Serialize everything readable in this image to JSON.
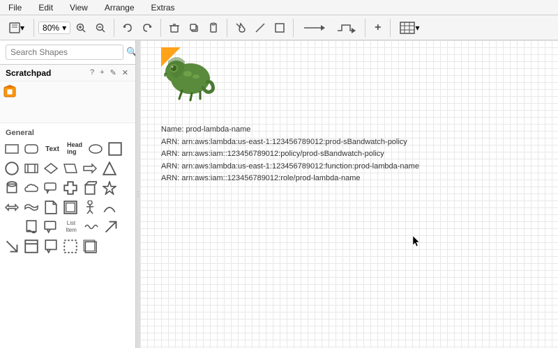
{
  "menubar": {
    "items": [
      "File",
      "Edit",
      "View",
      "Arrange",
      "Extras"
    ]
  },
  "toolbar": {
    "zoom_label": "80%",
    "zoom_icon": "▾",
    "undo_icon": "↺",
    "redo_icon": "↻",
    "delete_icon": "🗑",
    "copy_icon": "⧉",
    "paste_icon": "📋",
    "fill_icon": "◇",
    "line_icon": "╱",
    "rect_icon": "□",
    "arrow_icon": "→",
    "connector_icon": "⌐",
    "add_icon": "+",
    "table_icon": "⊞"
  },
  "sidebar": {
    "search_placeholder": "Search Shapes",
    "scratchpad_title": "Scratchpad",
    "scratchpad_help": "?",
    "scratchpad_add": "+",
    "scratchpad_edit": "✎",
    "scratchpad_close": "✕",
    "general_title": "General"
  },
  "canvas": {
    "shape_name": "Name: prod-lambda-name",
    "shape_arn1": "ARN: arn:aws:lambda:us-east-1:123456789012:prod-sBandwatch-policy",
    "shape_arn2": "ARN: arn:aws:iam::123456789012:policy/prod-sBandwatch-policy",
    "shape_arn3": "ARN: arn:aws:lambda:us-east-1:123456789012:function:prod-lambda-name",
    "shape_arn4": "ARN: arn:aws:iam::123456789012:role/prod-lambda-name"
  },
  "shapes": {
    "row1": [
      "rect",
      "rounded-rect",
      "text",
      "heading",
      "ellipse"
    ],
    "row2": [
      "rect",
      "circle",
      "process",
      "diamond",
      "parallelogram"
    ],
    "row3": [
      "arrow",
      "triangle",
      "cylinder",
      "cloud",
      "callout"
    ],
    "row4": [
      "cross",
      "cube",
      "star",
      "arrow2",
      "wave"
    ],
    "row5": [
      "note",
      "rect2",
      "person",
      "arc",
      ""
    ],
    "row6": [
      "rect3",
      "rect4",
      "listitem",
      "squiggle",
      "arrow3",
      "arrow4"
    ],
    "row7": [
      "rect5",
      "rect6",
      "rect7",
      "rect8",
      ""
    ]
  },
  "colors": {
    "accent": "#1e88e5",
    "border": "#cccccc",
    "bg": "#ffffff",
    "toolbar_bg": "#f5f5f5",
    "sidebar_bg": "#ffffff",
    "canvas_bg": "#ffffff",
    "grid_line": "#e8e8e8"
  }
}
